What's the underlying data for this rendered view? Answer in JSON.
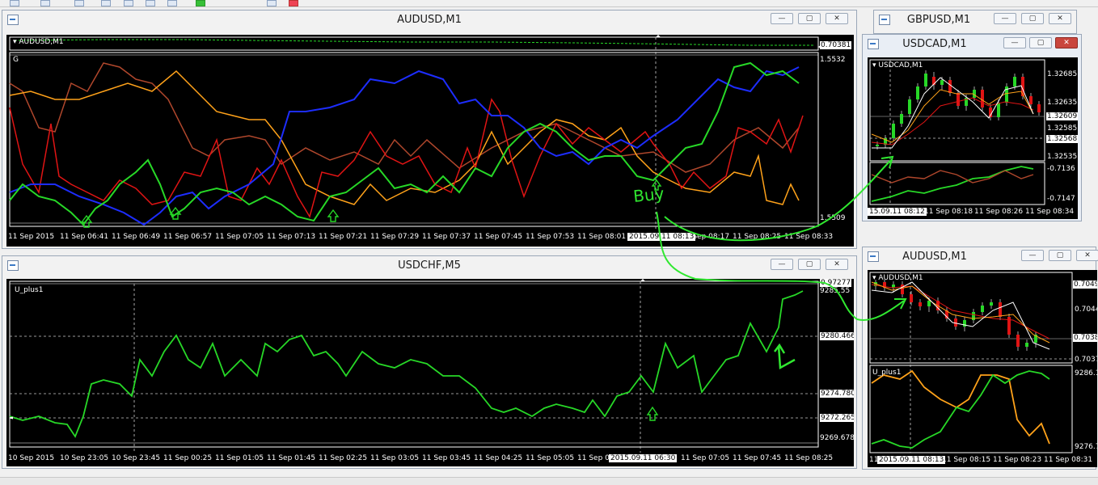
{
  "windows": {
    "audusd_main": {
      "title": "AUDUSD,M1",
      "indicator_label": "AUDUSD,M1",
      "sub_label": "G",
      "y_top": "0.70381",
      "y_a": "1.5532",
      "y_b": "1.5509",
      "x_labels": [
        "11 Sep 2015",
        "11 Sep 06:41",
        "11 Sep 06:49",
        "11 Sep 06:57",
        "11 Sep 07:05",
        "11 Sep 07:13",
        "11 Sep 07:21",
        "11 Sep 07:29",
        "11 Sep 07:37",
        "11 Sep 07:45",
        "11 Sep 07:53",
        "11 Sep 08:01",
        "11 Sep 08:17",
        "11 Sep 08:25",
        "11 Sep 08:33"
      ],
      "x_highlight": "2015.09.11 08:13"
    },
    "usdchf": {
      "title": "USDCHF,M5",
      "indicator_label": "U_plus1",
      "y_labels": [
        "0.97277",
        "9285.55",
        "9280.466",
        "9274.780",
        "9272.265",
        "9269.678"
      ],
      "x_labels": [
        "10 Sep 2015",
        "10 Sep 23:05",
        "10 Sep 23:45",
        "11 Sep 00:25",
        "11 Sep 01:05",
        "11 Sep 01:45",
        "11 Sep 02:25",
        "11 Sep 03:05",
        "11 Sep 03:45",
        "11 Sep 04:25",
        "11 Sep 05:05",
        "11 Sep 05:45",
        "11 Sep 07:05",
        "11 Sep 07:45",
        "11 Sep 08:25"
      ],
      "x_highlight": "2015.09.11 06:30"
    },
    "gbpusd": {
      "title": "GBPUSD,M1"
    },
    "usdcad": {
      "title": "USDCAD,M1",
      "indicator_label": "USDCAD,M1",
      "y_labels": [
        "1.32685",
        "1.32635",
        "1.32609",
        "1.32585",
        "1.32568",
        "1.32535",
        "-0.7136",
        "-0.7147"
      ],
      "x_labels": [
        "11 Sep 08:18",
        "11 Sep 08:26",
        "11 Sep 08:34"
      ],
      "x_highlight": "15.09.11 08:12"
    },
    "audusd_small": {
      "title": "AUDUSD,M1",
      "indicator_label": "AUDUSD,M1",
      "sub_label": "U_plus1",
      "y_labels": [
        "0.7049",
        "0.7044",
        "0.7038",
        "0.7037",
        "9286.1",
        "9276.7"
      ],
      "x_labels": [
        "11",
        "11 Sep 08:15",
        "11 Sep 08:23",
        "11 Sep 08:31"
      ],
      "x_highlight": "2015.09.11 08:13"
    }
  },
  "annotation": {
    "text": "Buy"
  },
  "window_buttons": {
    "minimize": "—",
    "maximize": "▢",
    "close": "✕"
  },
  "colors": {
    "green": "#27d827",
    "red": "#e01414",
    "blue": "#1d2dff",
    "orange": "#ffa21a",
    "brown": "#b0472c",
    "annotation": "#30e830"
  }
}
